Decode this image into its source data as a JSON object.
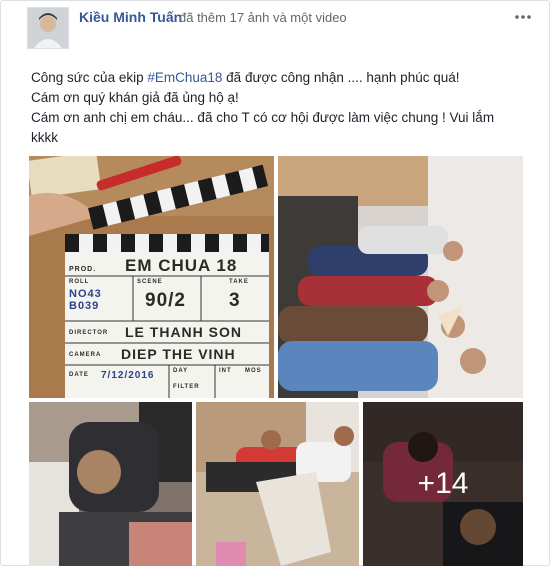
{
  "post": {
    "author_name": "Kiều Minh Tuấn",
    "action_text": "đã thêm 17 ảnh và một video",
    "more_icon": "ellipsis-icon",
    "text_lines": [
      {
        "before": "Công sức của ekip ",
        "hashtag": "#EmChua18",
        "after": " đã được công nhận .... hạnh phúc quá!"
      },
      {
        "before": "Cám ơn quý khán giả đã ủng hộ ạ!",
        "hashtag": "",
        "after": ""
      },
      {
        "before": "Cám ơn anh chị em cháu... đã cho T có cơ hội được làm việc chung ! Vui lắm",
        "hashtag": "",
        "after": ""
      },
      {
        "before": "kkkk",
        "hashtag": "",
        "after": ""
      }
    ]
  },
  "photos": {
    "clapperboard": {
      "prod": "EM CHUA 18",
      "roll": "NO43 B039",
      "scene": "90/2",
      "take": "3",
      "director": "LE THANH SON",
      "camera": "DIEP THE VINH",
      "date": "7/12/2016",
      "labels": {
        "prod": "PROD.",
        "roll": "ROLL",
        "scene": "SCENE",
        "take": "TAKE",
        "director": "DIRECTOR",
        "camera": "CAMERA",
        "date": "DATE",
        "day": "DAY",
        "int": "INT",
        "mos": "MOS",
        "filter": "FILTER"
      }
    },
    "more_count": "+14"
  }
}
